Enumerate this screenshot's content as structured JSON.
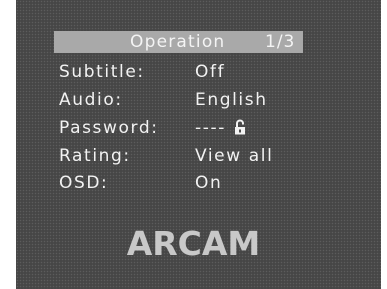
{
  "menu": {
    "title": "Operation",
    "page": "1/3",
    "items": [
      {
        "label": "Subtitle:",
        "value": "Off"
      },
      {
        "label": "Audio:",
        "value": "English"
      },
      {
        "label": "Password:",
        "value": "----",
        "icon": "open-padlock-icon"
      },
      {
        "label": "Rating:",
        "value": "View all"
      },
      {
        "label": "OSD:",
        "value": "On"
      }
    ]
  },
  "brand": {
    "logo": "ARCAM"
  },
  "colors": {
    "screen_background": "#4a4a4a",
    "title_bar": "#a9a9a9",
    "text": "#f2f2f2",
    "logo": "#c8c8c8"
  }
}
